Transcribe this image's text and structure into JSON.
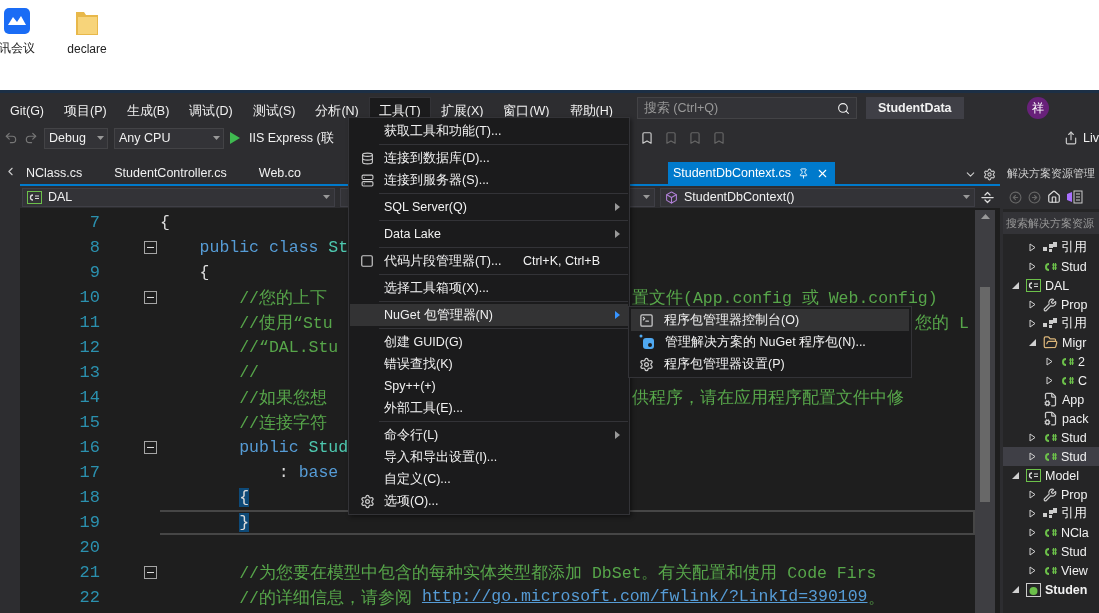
{
  "desktop": {
    "icons": [
      {
        "label": "讯会议",
        "kind": "meeting"
      },
      {
        "label": "declare",
        "kind": "folder"
      }
    ]
  },
  "menu_bar": {
    "items": [
      {
        "label": "Git(G)",
        "selected": false
      },
      {
        "label": "项目(P)",
        "selected": false
      },
      {
        "label": "生成(B)",
        "selected": false
      },
      {
        "label": "调试(D)",
        "selected": false
      },
      {
        "label": "测试(S)",
        "selected": false
      },
      {
        "label": "分析(N)",
        "selected": false
      },
      {
        "label": "工具(T)",
        "selected": true
      },
      {
        "label": "扩展(X)",
        "selected": false
      },
      {
        "label": "窗口(W)",
        "selected": false
      },
      {
        "label": "帮助(H)",
        "selected": false
      }
    ],
    "search": {
      "placeholder": "搜索 (Ctrl+Q)"
    },
    "title": "StudentData",
    "avatar": "祥"
  },
  "toolbar": {
    "configuration": "Debug",
    "platform": "Any CPU",
    "run_target": "IIS Express (联",
    "share": "Liv"
  },
  "tabs": [
    {
      "label": "NClass.cs",
      "selected": false
    },
    {
      "label": "StudentController.cs",
      "selected": false
    },
    {
      "label": "Web.co",
      "selected": false
    },
    {
      "label": "StudentDbContext.cs",
      "selected": true
    }
  ],
  "navigation": {
    "project": "DAL",
    "member": "StudentDbContext()"
  },
  "editor": {
    "lines": [
      {
        "number": "7",
        "fold": false,
        "current": false,
        "matched": false,
        "tokens": [
          {
            "kind": "brace",
            "text": "{"
          }
        ]
      },
      {
        "number": "8",
        "fold": true,
        "current": false,
        "matched": false,
        "tokens": [
          {
            "kind": "keyword",
            "text": "    public class "
          },
          {
            "kind": "type",
            "text": "St"
          }
        ]
      },
      {
        "number": "9",
        "fold": false,
        "current": false,
        "matched": false,
        "tokens": [
          {
            "kind": "brace",
            "text": "    {"
          }
        ]
      },
      {
        "number": "10",
        "fold": true,
        "current": false,
        "matched": false,
        "tokens": [
          {
            "kind": "comment",
            "text": "        //您的上下"
          }
        ],
        "right": {
          "kind": "after_menu",
          "tokens": [
            {
              "kind": "comment",
              "text": "置文件(App.config 或 Web.config)"
            }
          ]
        }
      },
      {
        "number": "11",
        "fold": false,
        "current": false,
        "matched": false,
        "tokens": [
          {
            "kind": "comment",
            "text": "        //使用“Stu"
          }
        ],
        "right": {
          "kind": "after_submenu",
          "tokens": [
            {
              "kind": "comment",
              "text": "您的 L"
            }
          ]
        }
      },
      {
        "number": "12",
        "fold": false,
        "current": false,
        "matched": false,
        "tokens": [
          {
            "kind": "comment",
            "text": "        //“DAL.Stu"
          }
        ]
      },
      {
        "number": "13",
        "fold": false,
        "current": false,
        "matched": false,
        "tokens": [
          {
            "kind": "comment",
            "text": "        //"
          }
        ]
      },
      {
        "number": "14",
        "fold": false,
        "current": false,
        "matched": false,
        "tokens": [
          {
            "kind": "comment",
            "text": "        //如果您想"
          }
        ],
        "right": {
          "kind": "after_menu",
          "tokens": [
            {
              "kind": "comment",
              "text": "供程序，请在应用程序配置文件中修"
            }
          ]
        }
      },
      {
        "number": "15",
        "fold": false,
        "current": false,
        "matched": false,
        "tokens": [
          {
            "kind": "comment",
            "text": "        //连接字符"
          }
        ]
      },
      {
        "number": "16",
        "fold": true,
        "current": false,
        "matched": false,
        "tokens": [
          {
            "kind": "keyword",
            "text": "        public "
          },
          {
            "kind": "type",
            "text": "Stud"
          }
        ]
      },
      {
        "number": "17",
        "fold": false,
        "current": false,
        "matched": false,
        "tokens": [
          {
            "kind": "plain",
            "text": "            : "
          },
          {
            "kind": "keyword",
            "text": "base"
          }
        ]
      },
      {
        "number": "18",
        "fold": false,
        "current": false,
        "matched": true,
        "tokens": [
          {
            "kind": "brace",
            "text": "        {"
          }
        ]
      },
      {
        "number": "19",
        "fold": false,
        "current": true,
        "matched": true,
        "tokens": [
          {
            "kind": "brace",
            "text": "        }"
          }
        ]
      },
      {
        "number": "20",
        "fold": false,
        "current": false
      },
      {
        "number": "21",
        "fold": true,
        "current": false,
        "matched": false,
        "tokens": [
          {
            "kind": "comment",
            "text": "        //为您要在模型中包含的每种实体类型都添加 DbSet。有关配置和使用 Code Firs"
          }
        ]
      },
      {
        "number": "22",
        "fold": false,
        "current": false,
        "matched": false,
        "tokens": [
          {
            "kind": "comment",
            "text": "        //的详细信息，请参阅 "
          },
          {
            "kind": "link",
            "text": "http://go.microsoft.com/fwlink/?LinkId=390109"
          },
          {
            "kind": "comment",
            "text": "。"
          }
        ]
      }
    ]
  },
  "tools_menu": {
    "items": [
      {
        "kind": "item",
        "label": "获取工具和功能(T)...",
        "submenu": false,
        "selected": false
      },
      {
        "kind": "separator"
      },
      {
        "kind": "database",
        "label": "连接到数据库(D)...",
        "submenu": false,
        "selected": false
      },
      {
        "kind": "server",
        "label": "连接到服务器(S)...",
        "submenu": false,
        "selected": false
      },
      {
        "kind": "separator"
      },
      {
        "kind": "item",
        "label": "SQL Server(Q)",
        "submenu": true,
        "selected": false
      },
      {
        "kind": "separator"
      },
      {
        "kind": "item",
        "label": "Data Lake",
        "submenu": true,
        "selected": false
      },
      {
        "kind": "separator"
      },
      {
        "kind": "snippet",
        "label": "代码片段管理器(T)...",
        "shortcut": "Ctrl+K, Ctrl+B",
        "submenu": false,
        "selected": false
      },
      {
        "kind": "separator"
      },
      {
        "kind": "item",
        "label": "选择工具箱项(X)...",
        "submenu": false,
        "selected": false
      },
      {
        "kind": "separator"
      },
      {
        "kind": "item",
        "label": "NuGet 包管理器(N)",
        "submenu": true,
        "selected": true
      },
      {
        "kind": "separator"
      },
      {
        "kind": "item",
        "label": "创建 GUID(G)",
        "submenu": false,
        "selected": false
      },
      {
        "kind": "item",
        "label": "错误查找(K)",
        "submenu": false,
        "selected": false
      },
      {
        "kind": "item",
        "label": "Spy++(+)",
        "submenu": false,
        "selected": false
      },
      {
        "kind": "item",
        "label": "外部工具(E)...",
        "submenu": false,
        "selected": false
      },
      {
        "kind": "separator"
      },
      {
        "kind": "item",
        "label": "命令行(L)",
        "submenu": true,
        "selected": false
      },
      {
        "kind": "item",
        "label": "导入和导出设置(I)...",
        "submenu": false,
        "selected": false
      },
      {
        "kind": "item",
        "label": "自定义(C)...",
        "submenu": false,
        "selected": false
      },
      {
        "kind": "gear",
        "label": "选项(O)...",
        "submenu": false,
        "selected": false
      }
    ]
  },
  "nuget_submenu": {
    "items": [
      {
        "kind": "console",
        "label": "程序包管理器控制台(O)",
        "selected": true
      },
      {
        "kind": "package",
        "label": "管理解决方案的 NuGet 程序包(N)...",
        "selected": false
      },
      {
        "kind": "gear",
        "label": "程序包管理器设置(P)",
        "selected": false
      }
    ]
  },
  "solution_explorer": {
    "title": "解决方案资源管理",
    "search": {
      "placeholder": "搜索解决方案资源"
    },
    "tree": [
      {
        "children": [
          {
            "label": "引用",
            "kind": "references",
            "expanded": false,
            "selected": false
          },
          {
            "label": "Stud",
            "kind": "csharp",
            "expanded": false,
            "selected": false
          }
        ]
      },
      {
        "label": "DAL",
        "kind": "project",
        "expanded": true,
        "selected": false,
        "children": [
          {
            "label": "Prop",
            "kind": "properties",
            "expanded": false,
            "selected": false
          },
          {
            "label": "引用",
            "kind": "references",
            "expanded": false,
            "selected": false
          },
          {
            "label": "Migr",
            "kind": "folder",
            "expanded": true,
            "selected": false,
            "children": [
              {
                "label": "2",
                "kind": "csharp",
                "expanded": false,
                "selected": false
              },
              {
                "label": "C",
                "kind": "csharp",
                "expanded": false,
                "selected": false
              }
            ]
          },
          {
            "label": "App",
            "kind": "config",
            "selected": false
          },
          {
            "label": "pack",
            "kind": "config",
            "selected": false
          },
          {
            "label": "Stud",
            "kind": "csharp",
            "expanded": false,
            "selected": false
          },
          {
            "label": "Stud",
            "kind": "csharp",
            "expanded": false,
            "selected": true
          }
        ]
      },
      {
        "label": "Model",
        "kind": "project",
        "expanded": true,
        "selected": false,
        "children": [
          {
            "label": "Prop",
            "kind": "properties",
            "expanded": false,
            "selected": false
          },
          {
            "label": "引用",
            "kind": "references",
            "expanded": false,
            "selected": false
          },
          {
            "label": "NCla",
            "kind": "csharp",
            "expanded": false,
            "selected": false
          },
          {
            "label": "Stud",
            "kind": "csharp",
            "expanded": false,
            "selected": false
          },
          {
            "label": "View",
            "kind": "csharp",
            "expanded": false,
            "selected": false
          }
        ]
      },
      {
        "label": "Studen",
        "kind": "web",
        "expanded": true,
        "selected": false
      }
    ]
  }
}
